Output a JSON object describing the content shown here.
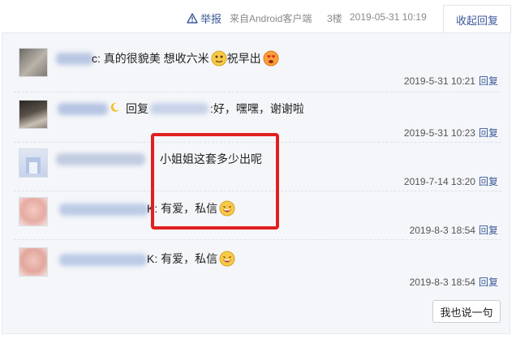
{
  "header": {
    "report_label": "举报",
    "source": "来自Android客户端",
    "floor": "3楼",
    "datetime": "2019-05-31 10:19",
    "collapse_label": "收起回复"
  },
  "comments": [
    {
      "text_before": "c: 真的很貌美 想收六米",
      "text_after": " 祝早出",
      "time": "2019-5-31 10:21",
      "reply_label": "回复"
    },
    {
      "text_before": "回复",
      "text_after": ":好，嘿嘿，谢谢啦",
      "time": "2019-5-31 10:23",
      "reply_label": "回复"
    },
    {
      "text_before": "小姐姐这套多少出呢",
      "time": "2019-7-14 13:20",
      "reply_label": "回复"
    },
    {
      "text_before": "K: 有爱，私信",
      "time": "2019-8-3 18:54",
      "reply_label": "回复"
    },
    {
      "text_before": "K: 有爱，私信",
      "time": "2019-8-3 18:54",
      "reply_label": "回复"
    }
  ],
  "footer": {
    "say_button": "我也说一句"
  },
  "colors": {
    "highlight_box": "#e02020",
    "link": "#3b5998"
  }
}
